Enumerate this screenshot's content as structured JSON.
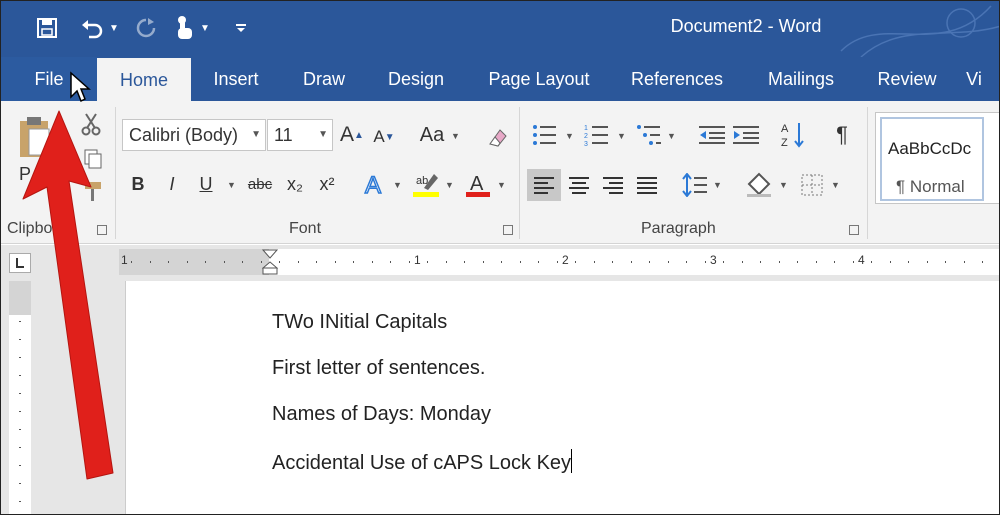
{
  "window": {
    "title": "Document2 - Word"
  },
  "quick_access": {
    "save_icon": "save-icon",
    "undo_icon": "undo-icon",
    "redo_icon": "redo-icon",
    "touch_icon": "touch-mode-icon",
    "customize_icon": "customize-qat-icon"
  },
  "tabs": [
    "File",
    "Home",
    "Insert",
    "Draw",
    "Design",
    "Page Layout",
    "References",
    "Mailings",
    "Review",
    "Vi"
  ],
  "active_tab": "Home",
  "ribbon": {
    "clipboard": {
      "label": "Clipbo",
      "paste_letter": "P"
    },
    "font": {
      "label": "Font",
      "font_name": "Calibri (Body)",
      "font_size": "11",
      "change_case": "Aa",
      "bold": "B",
      "italic": "I",
      "underline": "U",
      "strike": "abc",
      "subscript": "x₂",
      "superscript": "x²",
      "grow": "A",
      "shrink": "A"
    },
    "paragraph": {
      "label": "Paragraph",
      "pilcrow": "¶"
    },
    "styles": {
      "preview": "AaBbCcDc",
      "name": "¶ Normal"
    }
  },
  "ruler": {
    "numbers": [
      "1",
      "1",
      "2",
      "3",
      "4"
    ]
  },
  "document": {
    "paragraphs": [
      "TWo INitial Capitals",
      "First letter of sentences.",
      "Names of Days: Monday",
      "Accidental Use of cAPS Lock Key"
    ]
  },
  "colors": {
    "brand": "#2b579a",
    "ribbon_bg": "#f3f3f3",
    "arrow": "#e0201b",
    "highlight": "#ffff00",
    "font_color": "#e0201b"
  }
}
